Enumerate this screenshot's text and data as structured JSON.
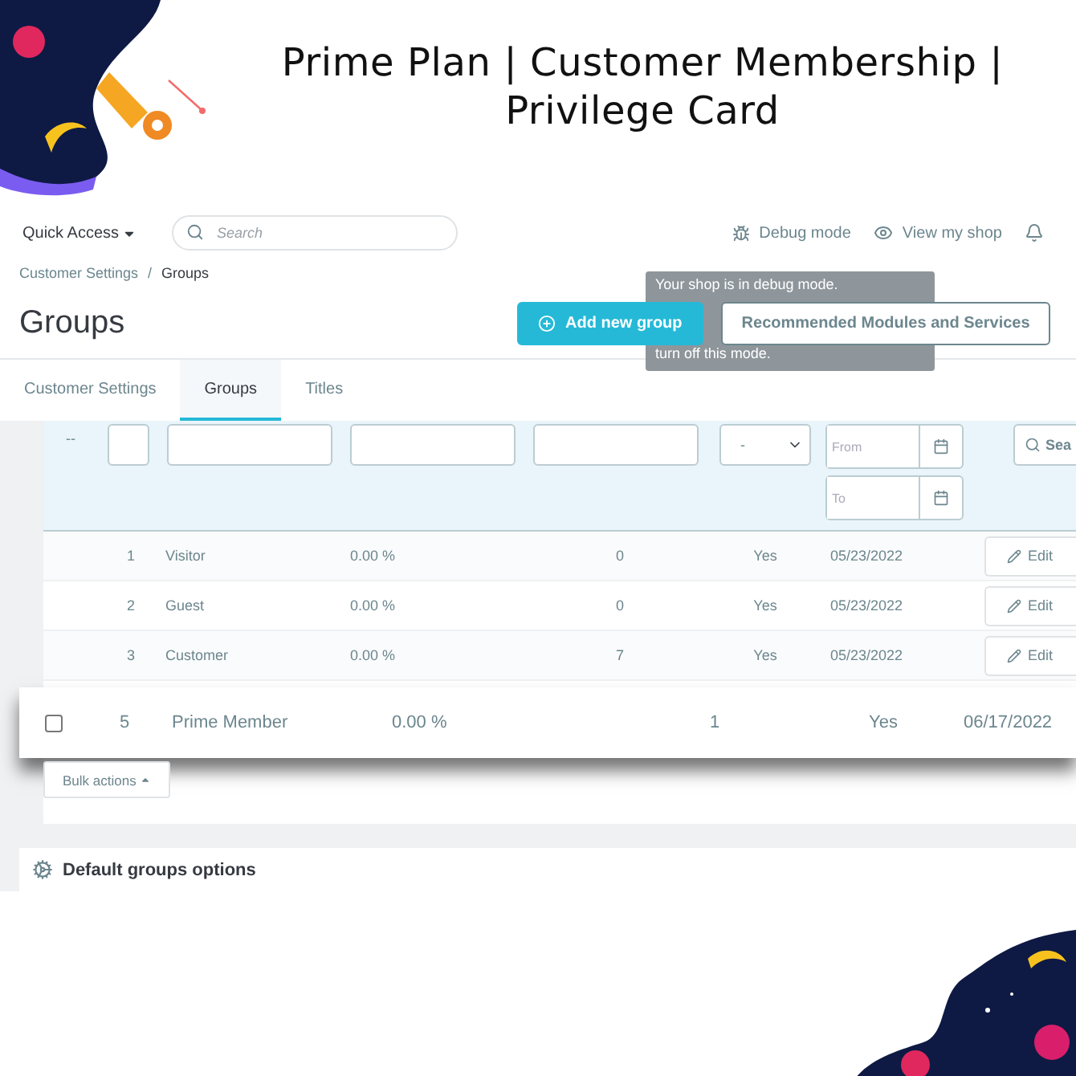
{
  "title": "Prime Plan | Customer Membership | Privilege Card",
  "topbar": {
    "quick_access": "Quick Access",
    "search": {
      "placeholder": "Search"
    },
    "debug": "Debug mode",
    "view_shop": "View my shop"
  },
  "breadcrumb": [
    "Customer Settings",
    "Groups"
  ],
  "breadcrumb_separator": "/",
  "page_title": "Groups",
  "toolbar_buttons": [
    {
      "label": "Add new group",
      "kind": "primary"
    },
    {
      "label": "Recommended Modules and Services",
      "kind": "outline"
    }
  ],
  "tooltip_lines": [
    "Your shop is in debug mode.",
    "turn off this mode."
  ],
  "tabs": [
    {
      "label": "Customer Settings",
      "selected": false
    },
    {
      "label": "Groups",
      "selected": true
    },
    {
      "label": "Titles",
      "selected": false
    }
  ],
  "filters": {
    "bulk_marker": "--",
    "show_prices": "-",
    "date_from_placeholder": "From",
    "date_to_placeholder": "To",
    "search_button": "Sea"
  },
  "rows": [
    {
      "id": "1",
      "name": "Visitor",
      "reduction": "0.00 %",
      "members": "0",
      "show_prices": "Yes",
      "created": "05/23/2022",
      "action": "Edit"
    },
    {
      "id": "2",
      "name": "Guest",
      "reduction": "0.00 %",
      "members": "0",
      "show_prices": "Yes",
      "created": "05/23/2022",
      "action": "Edit"
    },
    {
      "id": "3",
      "name": "Customer",
      "reduction": "0.00 %",
      "members": "7",
      "show_prices": "Yes",
      "created": "05/23/2022",
      "action": "Edit"
    }
  ],
  "highlighted_row": {
    "checked": false,
    "id": "5",
    "name": "Prime Member",
    "reduction": "0.00 %",
    "members": "1",
    "show_prices": "Yes",
    "created": "06/17/2022"
  },
  "bulk_actions": "Bulk actions",
  "options_panel": "Default groups options"
}
